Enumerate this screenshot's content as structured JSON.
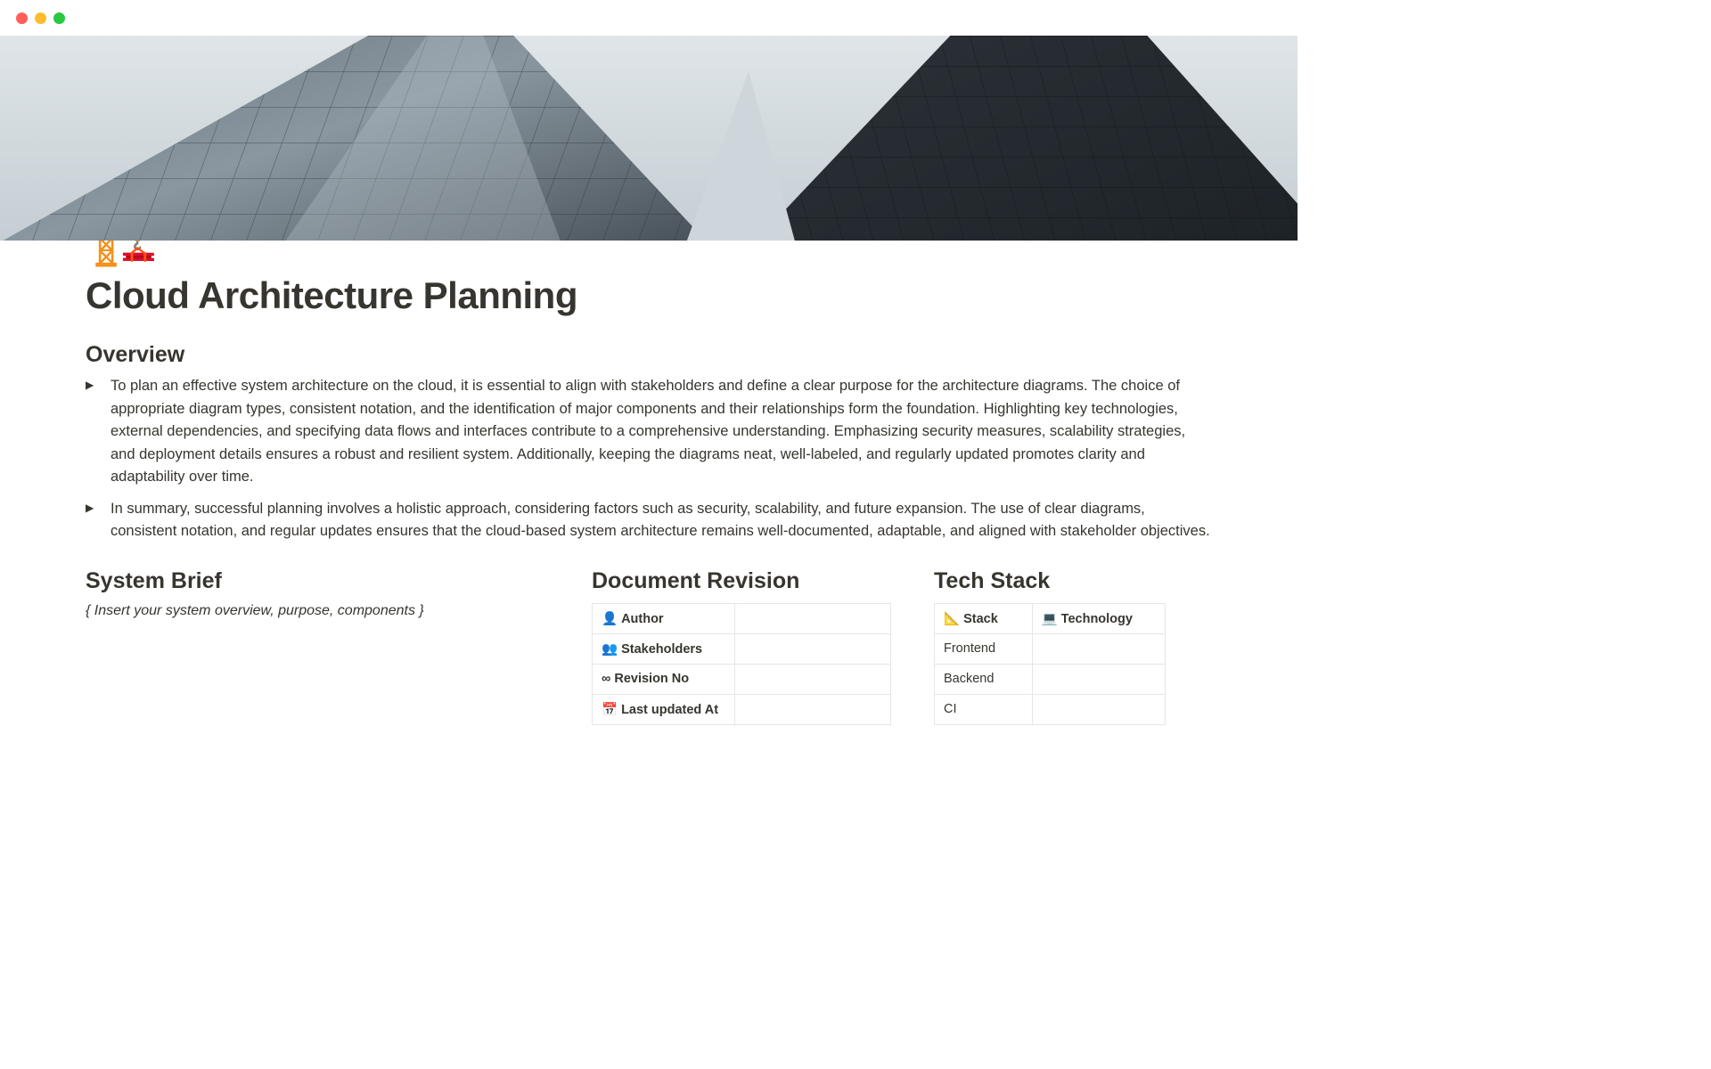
{
  "page": {
    "icon": "🏗️",
    "title": "Cloud Architecture Planning"
  },
  "overview": {
    "heading": "Overview",
    "paragraphs": [
      "To plan an effective system architecture on the cloud, it is essential to align with stakeholders and define a clear purpose for the architecture diagrams. The choice of appropriate diagram types, consistent notation, and the identification of major components and their relationships form the foundation. Highlighting key technologies, external dependencies, and specifying data flows and interfaces contribute to a comprehensive understanding. Emphasizing security measures, scalability strategies, and deployment details ensures a robust and resilient system. Additionally, keeping the diagrams neat, well-labeled, and regularly updated promotes clarity and adaptability over time.",
      "In summary, successful planning involves a holistic approach, considering factors such as security, scalability, and future expansion. The use of clear diagrams, consistent notation, and regular updates ensures that the cloud-based system architecture remains well-documented, adaptable, and aligned with stakeholder objectives."
    ]
  },
  "brief": {
    "heading": "System Brief",
    "placeholder": "{ Insert your system overview, purpose, components }"
  },
  "revision": {
    "heading": "Document Revision",
    "rows": [
      {
        "icon": "👤",
        "label": "Author",
        "value": ""
      },
      {
        "icon": "👥",
        "label": "Stakeholders",
        "value": ""
      },
      {
        "icon": "∞",
        "label": "Revision No",
        "value": ""
      },
      {
        "icon": "📅",
        "label": "Last updated At",
        "value": ""
      }
    ]
  },
  "techstack": {
    "heading": "Tech Stack",
    "headers": {
      "stack_icon": "📐",
      "stack_label": "Stack",
      "tech_icon": "💻",
      "tech_label": "Technology"
    },
    "rows": [
      {
        "stack": "Frontend",
        "tech": ""
      },
      {
        "stack": "Backend",
        "tech": ""
      },
      {
        "stack": "CI",
        "tech": ""
      }
    ]
  }
}
